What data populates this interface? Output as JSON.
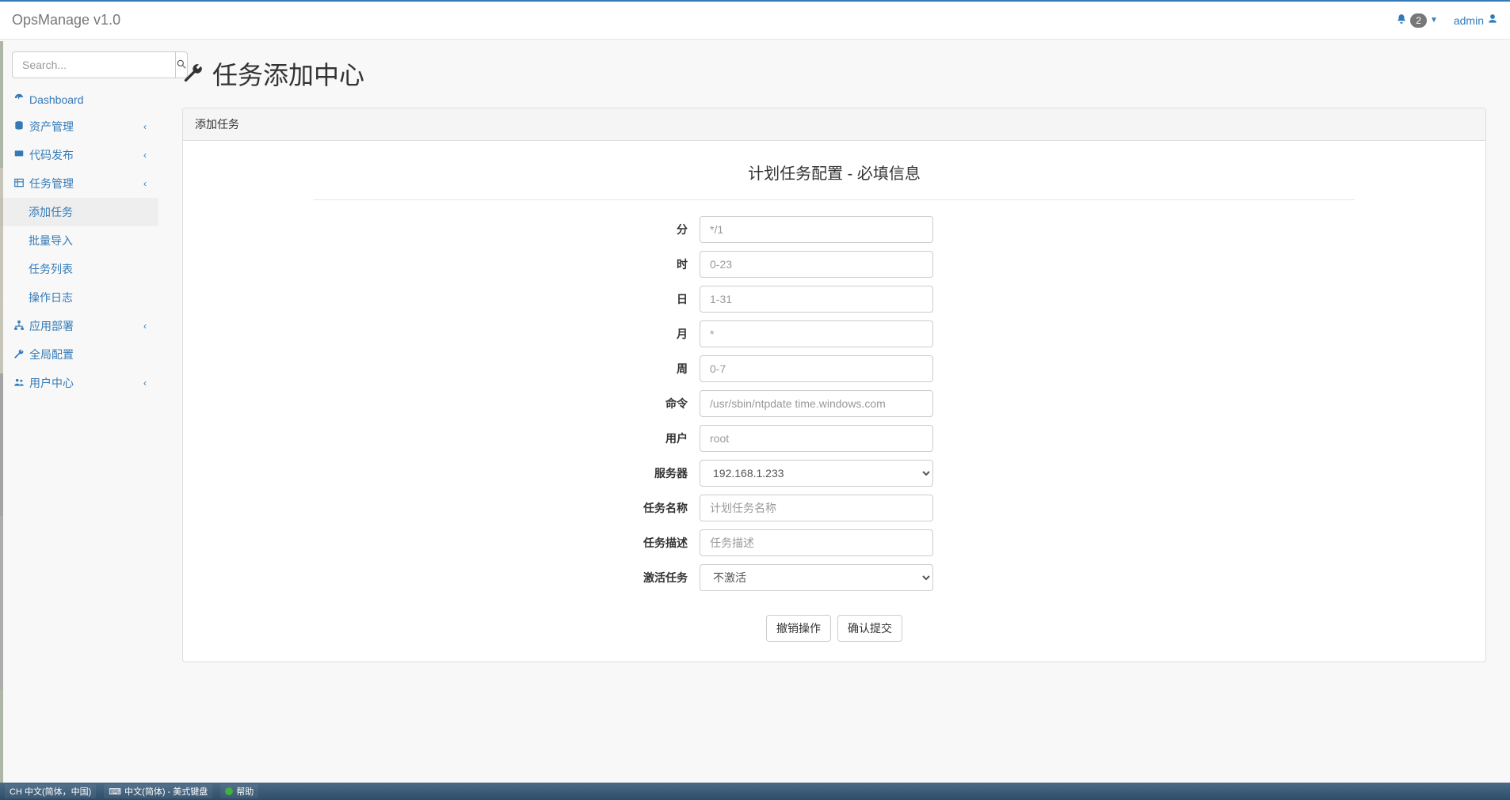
{
  "brand": "OpsManage v1.0",
  "navbar": {
    "notification_count": "2",
    "user_label": "admin"
  },
  "search": {
    "placeholder": "Search..."
  },
  "sidebar": {
    "dashboard": "Dashboard",
    "assets": "资产管理",
    "deploy": "代码发布",
    "cron": "任务管理",
    "cron_children": {
      "add": "添加任务",
      "import": "批量导入",
      "list": "任务列表",
      "log": "操作日志"
    },
    "app_deploy": "应用部署",
    "global_config": "全局配置",
    "user_center": "用户中心"
  },
  "page": {
    "title": "任务添加中心",
    "panel_title": "添加任务",
    "legend": "计划任务配置 - 必填信息"
  },
  "form": {
    "minute": {
      "label": "分",
      "placeholder": "*/1",
      "value": ""
    },
    "hour": {
      "label": "时",
      "placeholder": "0-23",
      "value": ""
    },
    "day": {
      "label": "日",
      "placeholder": "1-31",
      "value": ""
    },
    "month": {
      "label": "月",
      "placeholder": "*",
      "value": ""
    },
    "week": {
      "label": "周",
      "placeholder": "0-7",
      "value": ""
    },
    "command": {
      "label": "命令",
      "placeholder": "/usr/sbin/ntpdate time.windows.com",
      "value": ""
    },
    "user": {
      "label": "用户",
      "placeholder": "root",
      "value": ""
    },
    "server": {
      "label": "服务器",
      "selected": "192.168.1.233"
    },
    "name": {
      "label": "任务名称",
      "placeholder": "计划任务名称",
      "value": ""
    },
    "desc": {
      "label": "任务描述",
      "placeholder": "任务描述",
      "value": ""
    },
    "active": {
      "label": "激活任务",
      "selected": "不激活"
    }
  },
  "buttons": {
    "reset": "撤销操作",
    "submit": "确认提交"
  },
  "taskbar": {
    "ime1": "CH 中文(简体，中国)",
    "ime2": "中文(简体) - 美式键盘",
    "help": "帮助"
  }
}
